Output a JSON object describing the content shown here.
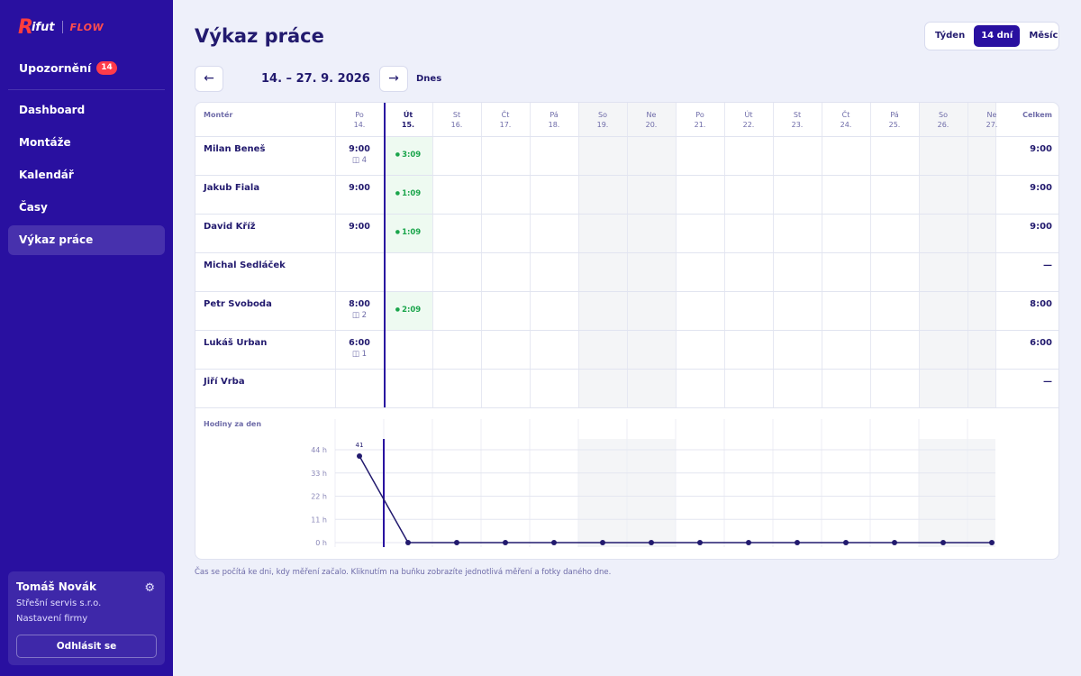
{
  "brand": {
    "r": "R",
    "word": "ifut",
    "flow": "FLOW"
  },
  "sidebar": {
    "notifications_label": "Upozornění",
    "notifications_count": "14",
    "items": [
      {
        "label": "Dashboard",
        "active": false
      },
      {
        "label": "Montáže",
        "active": false
      },
      {
        "label": "Kalendář",
        "active": false
      },
      {
        "label": "Časy",
        "active": false
      },
      {
        "label": "Výkaz práce",
        "active": true
      }
    ],
    "user": {
      "name": "Tomáš Novák",
      "company": "Střešní servis s.r.o.",
      "settings": "Nastavení firmy",
      "logout": "Odhlásit se",
      "gear_icon": "gear-icon"
    }
  },
  "header": {
    "title": "Výkaz práce",
    "ranges": [
      {
        "label": "Týden",
        "active": false
      },
      {
        "label": "14 dní",
        "active": true
      },
      {
        "label": "Měsíc",
        "active": false
      }
    ],
    "prev": "←",
    "next": "→",
    "date_range": "14. – 27. 9. 2026",
    "today": "Dnes"
  },
  "table": {
    "col_worker": "Montér",
    "col_total": "Celkem",
    "today_index": 1,
    "weekend_indices": [
      5,
      6,
      12,
      13
    ],
    "days": [
      {
        "dow": "Po",
        "date": "14."
      },
      {
        "dow": "Út",
        "date": "15."
      },
      {
        "dow": "St",
        "date": "16."
      },
      {
        "dow": "Čt",
        "date": "17."
      },
      {
        "dow": "Pá",
        "date": "18."
      },
      {
        "dow": "So",
        "date": "19."
      },
      {
        "dow": "Ne",
        "date": "20."
      },
      {
        "dow": "Po",
        "date": "21."
      },
      {
        "dow": "Út",
        "date": "22."
      },
      {
        "dow": "St",
        "date": "23."
      },
      {
        "dow": "Čt",
        "date": "24."
      },
      {
        "dow": "Pá",
        "date": "25."
      },
      {
        "dow": "So",
        "date": "26."
      },
      {
        "dow": "Ne",
        "date": "27."
      }
    ],
    "rows": [
      {
        "name": "Milan Beneš",
        "mon": "9:00",
        "photos": "4",
        "live": "3:09",
        "total": "9:00"
      },
      {
        "name": "Jakub Fiala",
        "mon": "9:00",
        "photos": "",
        "live": "1:09",
        "total": "9:00"
      },
      {
        "name": "David Kříž",
        "mon": "9:00",
        "photos": "",
        "live": "1:09",
        "total": "9:00"
      },
      {
        "name": "Michal Sedláček",
        "mon": "",
        "photos": "",
        "live": "",
        "total": "—"
      },
      {
        "name": "Petr Svoboda",
        "mon": "8:00",
        "photos": "2",
        "live": "2:09",
        "total": "8:00"
      },
      {
        "name": "Lukáš Urban",
        "mon": "6:00",
        "photos": "1",
        "live": "",
        "total": "6:00"
      },
      {
        "name": "Jiří Vrba",
        "mon": "",
        "photos": "",
        "live": "",
        "total": "—"
      }
    ]
  },
  "chart_data": {
    "type": "line",
    "title": "Hodiny za den",
    "y_ticks": [
      "44 h",
      "33 h",
      "22 h",
      "11 h",
      "0 h"
    ],
    "ylim": [
      0,
      44
    ],
    "values": [
      41,
      0,
      0,
      0,
      0,
      0,
      0,
      0,
      0,
      0,
      0,
      0,
      0,
      0
    ],
    "point_labels": [
      "41",
      "",
      "",
      "",
      "",
      "",
      "",
      "",
      "",
      "",
      "",
      "",
      "",
      ""
    ],
    "line_color": "#221a6e",
    "grid": true
  },
  "footnote": "Čas se počítá ke dni, kdy měření začalo. Kliknutím na buňku zobrazíte jednotlivá měření a fotky daného dne."
}
